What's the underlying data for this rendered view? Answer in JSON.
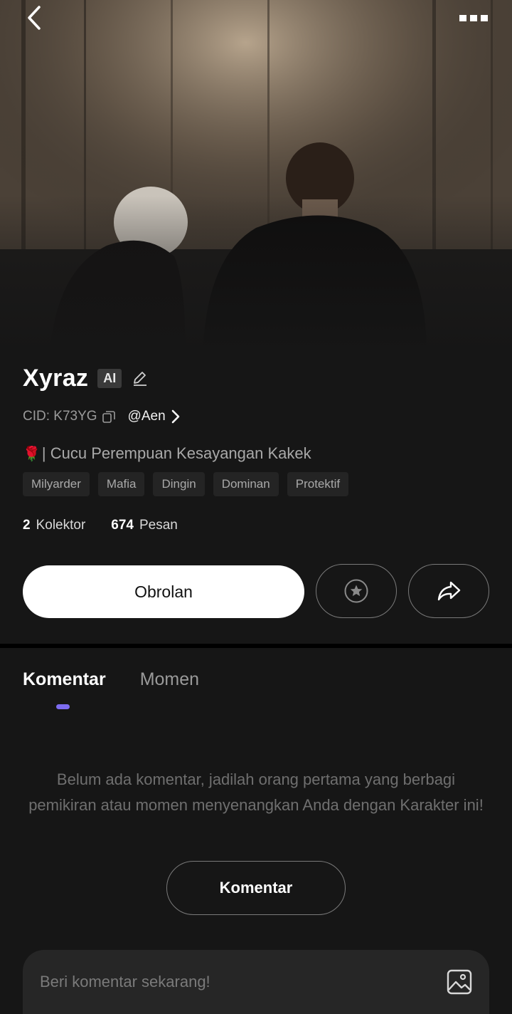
{
  "character": {
    "name": "Xyraz",
    "badge": "AI",
    "cid": "CID: K73YG",
    "author": "@Aen",
    "tagline_emoji": "🌹",
    "tagline": "| Cucu Perempuan Kesayangan Kakek",
    "tags": [
      "Milyarder",
      "Mafia",
      "Dingin",
      "Dominan",
      "Protektif"
    ]
  },
  "stats": {
    "collectors_count": "2",
    "collectors_label": "Kolektor",
    "messages_count": "674",
    "messages_label": "Pesan"
  },
  "actions": {
    "chat_label": "Obrolan"
  },
  "tabs": [
    {
      "label": "Komentar",
      "active": true
    },
    {
      "label": "Momen",
      "active": false
    }
  ],
  "comments": {
    "empty_message": "Belum ada komentar, jadilah orang pertama yang berbagi pemikiran atau momen menyenangkan Anda dengan Karakter ini!",
    "button_label": "Komentar",
    "input_placeholder": "Beri komentar sekarang!"
  },
  "icons": {
    "back": "chevron-left-icon",
    "more": "more-horizontal-icon",
    "edit": "pencil-icon",
    "copy": "copy-icon",
    "author_arrow": "chevron-right-icon",
    "favorite": "star-circle-icon",
    "share": "share-arrow-icon",
    "image": "image-icon"
  },
  "colors": {
    "background": "#161616",
    "accent": "#7d6cf0",
    "primary_button": "#ffffff"
  }
}
